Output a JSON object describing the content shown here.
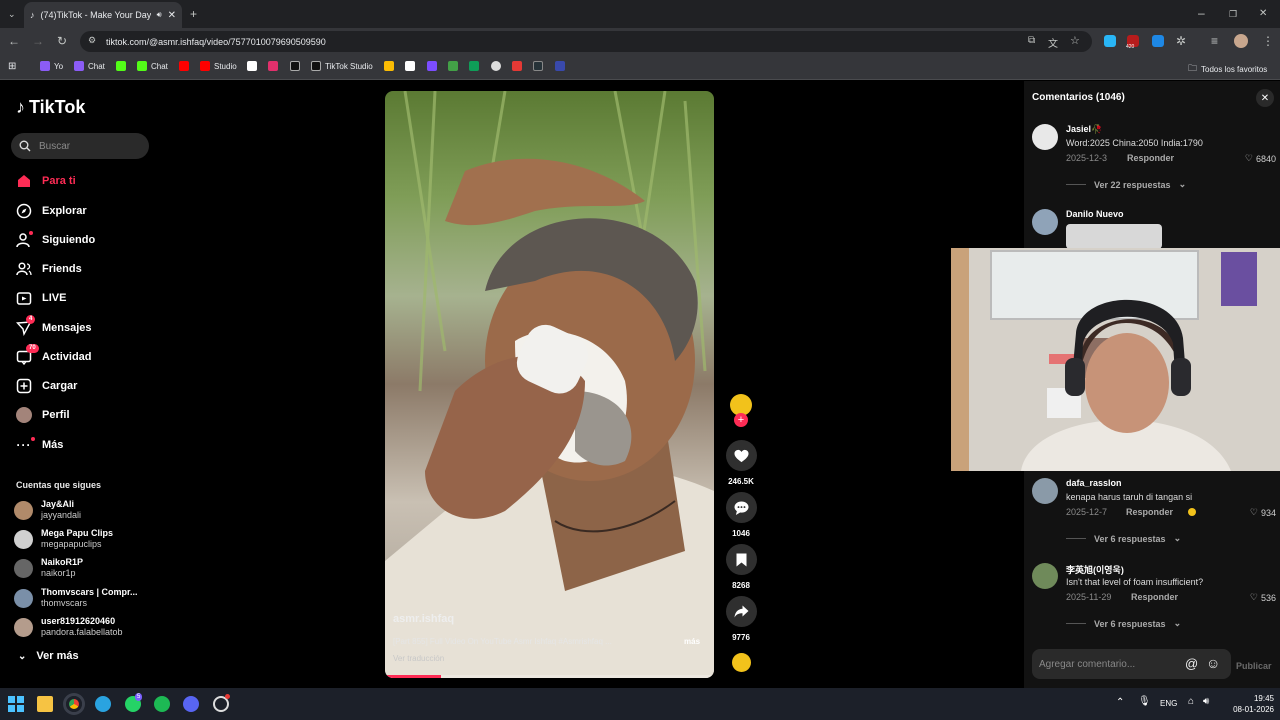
{
  "browser": {
    "tab_title": "(74)TikTok - Make Your Day",
    "url": "tiktok.com/@asmr.ishfaq/video/7577010079690509590",
    "bookmarks": [
      {
        "label": "Yo",
        "color": "#8b5cf6"
      },
      {
        "label": "Chat",
        "color": "#8b5cf6"
      },
      {
        "label": "",
        "color": "#53fc18"
      },
      {
        "label": "Chat",
        "color": "#53fc18"
      },
      {
        "label": "",
        "color": "#ff0000"
      },
      {
        "label": "Studio",
        "color": "#ff0000"
      },
      {
        "label": "",
        "color": "#ffffff"
      },
      {
        "label": "",
        "color": "#e1306c"
      },
      {
        "label": "",
        "color": "#111111"
      },
      {
        "label": "TikTok Studio",
        "color": "#111111"
      }
    ],
    "all_bookmarks": "Todos los favoritos",
    "ext_badge": "420"
  },
  "sidebar": {
    "logo_text": "TikTok",
    "search_placeholder": "Buscar",
    "nav": [
      {
        "label": "Para ti",
        "icon": "home-icon",
        "active": true
      },
      {
        "label": "Explorar",
        "icon": "compass-icon"
      },
      {
        "label": "Siguiendo",
        "icon": "following-icon"
      },
      {
        "label": "Friends",
        "icon": "friends-icon"
      },
      {
        "label": "LIVE",
        "icon": "live-icon"
      },
      {
        "label": "Mensajes",
        "icon": "messages-icon",
        "badge": "4"
      },
      {
        "label": "Actividad",
        "icon": "activity-icon",
        "badge": "70"
      },
      {
        "label": "Cargar",
        "icon": "upload-icon"
      },
      {
        "label": "Perfil",
        "icon": "profile-icon"
      },
      {
        "label": "Más",
        "icon": "more-icon"
      }
    ],
    "following_title": "Cuentas que sigues",
    "following": [
      {
        "name": "Jay&Ali",
        "handle": "jayyandali",
        "color": "#b08a6a"
      },
      {
        "name": "Mega Papu Clips",
        "handle": "megapapuclips",
        "color": "#d0d0d0"
      },
      {
        "name": "NaikoR1P",
        "handle": "naikor1p",
        "color": "#666"
      },
      {
        "name": "Thomvscars | Compr...",
        "handle": "thomvscars",
        "color": "#7a8fa8"
      },
      {
        "name": "user81912620460",
        "handle": "pandora.falabellatob",
        "color": "#b49c8c"
      }
    ],
    "see_more": "Ver más"
  },
  "video": {
    "author": "asmr.ishfaq",
    "caption": "[Part 855] Full Video On YouTube Asmr Ishfaq #Asmrishfaq ...",
    "more_label": "más",
    "translate": "Ver traducción",
    "progress": 0.17
  },
  "actions": {
    "likes": "246.5K",
    "comments": "1046",
    "saves": "8268",
    "shares": "9776"
  },
  "comments": {
    "header": "Comentarios (1046)",
    "items": [
      {
        "user": "Jasiel🥀",
        "text": "Word:2025 China:2050 India:1790",
        "date": "2025-12-3",
        "reply": "Responder",
        "likes": "6840",
        "more": "Ver 22 respuestas",
        "color": "#e8e8e8"
      },
      {
        "user": "Danilo Nuevo",
        "text": "",
        "date": "",
        "reply": "",
        "likes": "",
        "more": "",
        "color": "#8fa3b8"
      },
      {
        "user": "dafa_rasslon",
        "text": "kenapa harus taruh di tangan si",
        "date": "2025-12-7",
        "reply": "Responder",
        "likes": "934",
        "more": "Ver 6 respuestas",
        "color": "#8a9aa8"
      },
      {
        "user": "李英旭(이영욱)",
        "text": "Isn't that level of foam insufficient?",
        "date": "2025-11-29",
        "reply": "Responder",
        "likes": "536",
        "more": "Ver 6 respuestas",
        "color": "#6f8a5a"
      }
    ],
    "input_placeholder": "Agregar comentario...",
    "publish": "Publicar"
  },
  "taskbar": {
    "lang": "ENG",
    "time": "19:45",
    "date": "08-01-2026",
    "whatsapp_badge": "5"
  }
}
